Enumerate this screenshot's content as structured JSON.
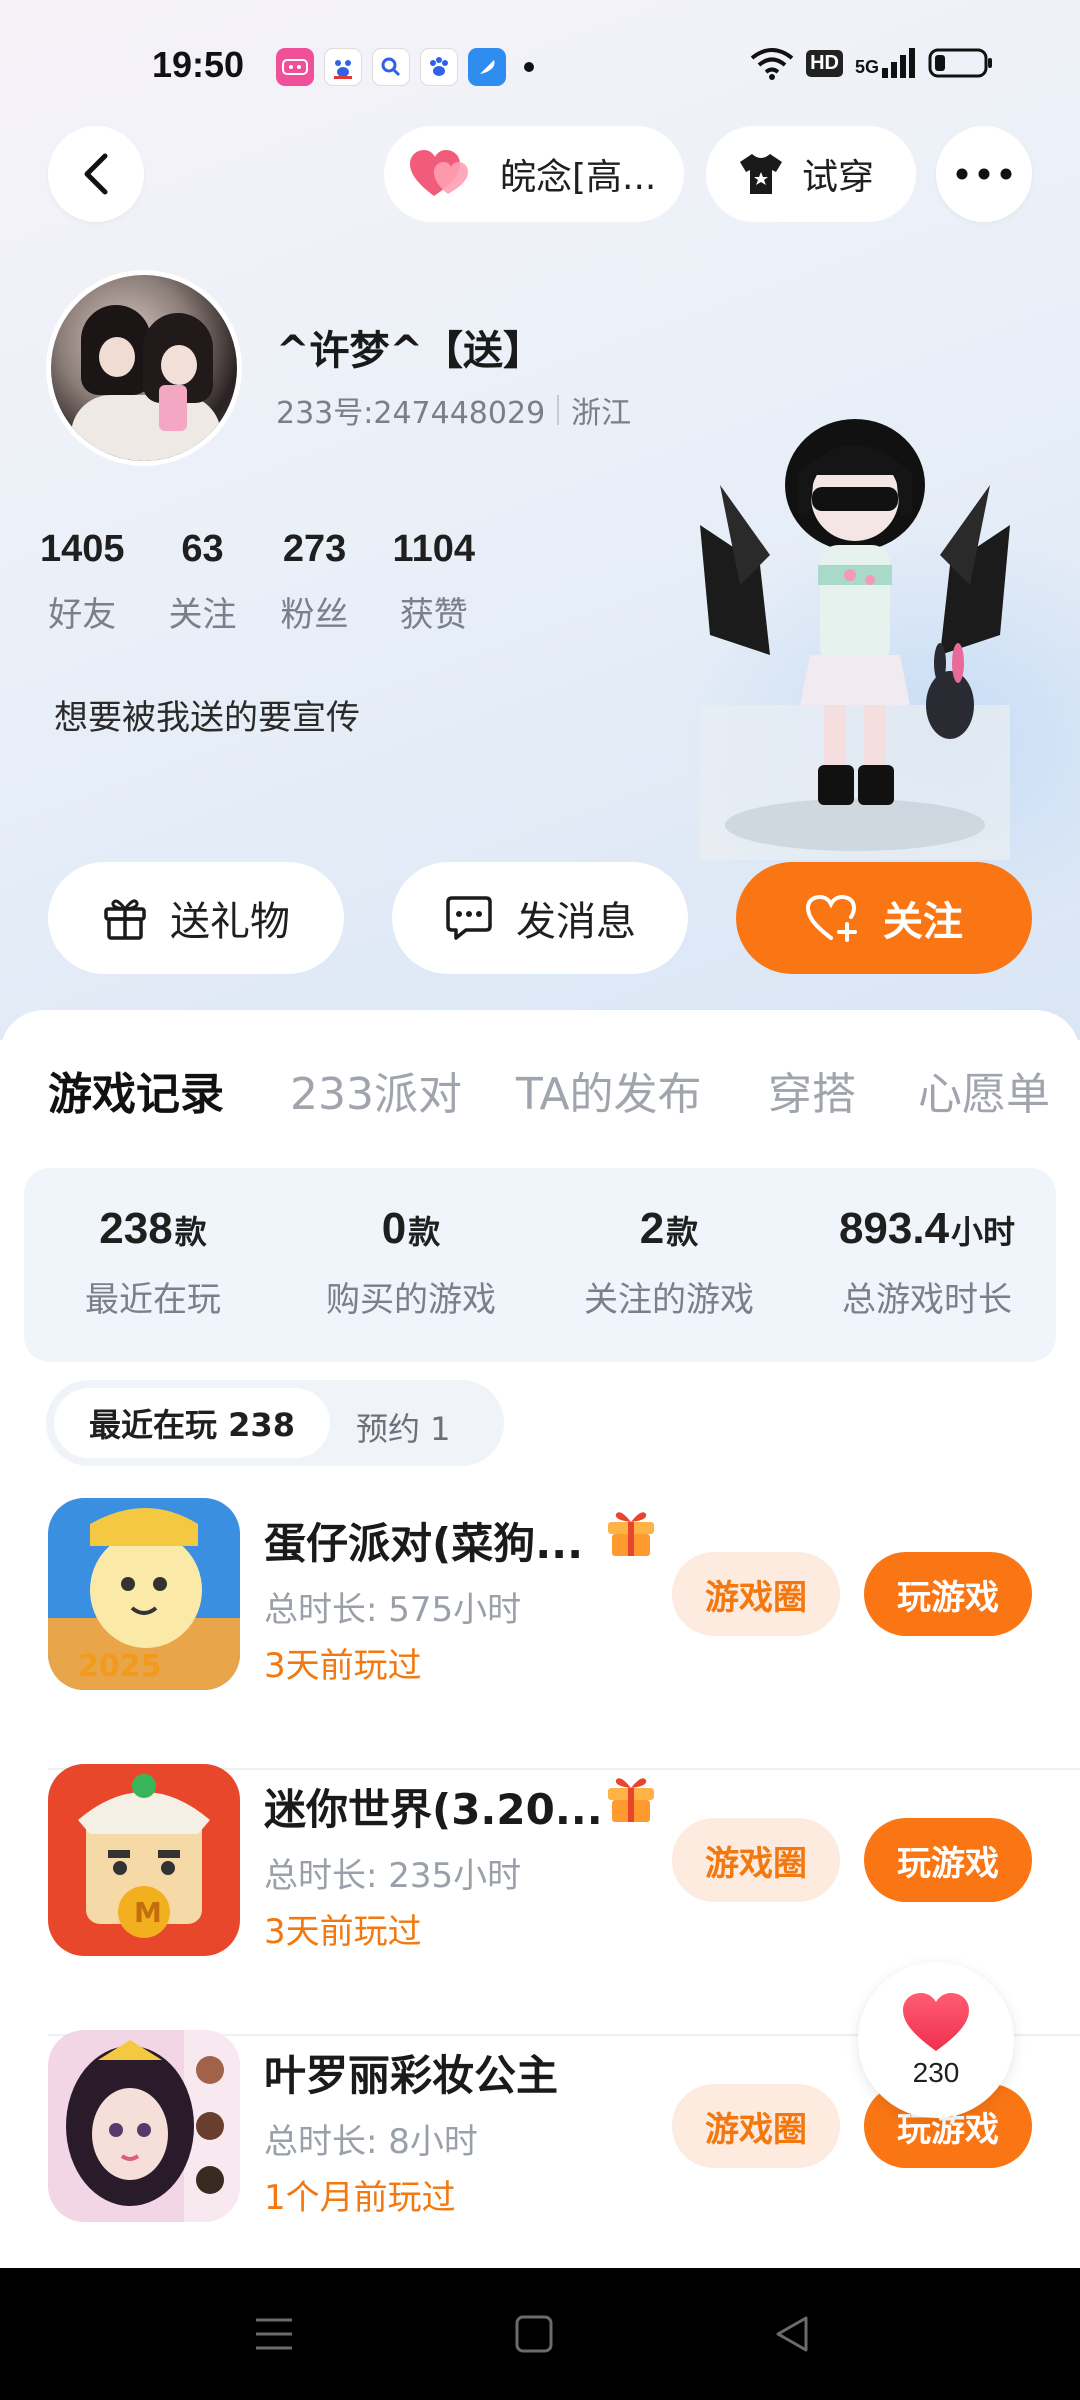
{
  "status_bar": {
    "time": "19:50",
    "network_label": "5G",
    "hd_label": "HD"
  },
  "header": {
    "friend_tag": "皖念[高...",
    "try_on_label": "试穿"
  },
  "profile": {
    "nickname": "^许梦^【送】",
    "uid": "233号:247448029",
    "region": "浙江",
    "bio": "想要被我送的要宣传",
    "stats": [
      {
        "value": "1405",
        "label": "好友"
      },
      {
        "value": "63",
        "label": "关注"
      },
      {
        "value": "273",
        "label": "粉丝"
      },
      {
        "value": "1104",
        "label": "获赞"
      }
    ]
  },
  "actions": {
    "gift": "送礼物",
    "message": "发消息",
    "follow": "关注"
  },
  "tabs": [
    {
      "label": "游戏记录",
      "active": true
    },
    {
      "label": "233派对",
      "active": false
    },
    {
      "label": "TA的发布",
      "active": false
    },
    {
      "label": "穿搭",
      "active": false
    },
    {
      "label": "心愿单",
      "active": false
    }
  ],
  "summary": [
    {
      "value": "238",
      "unit": "款",
      "label": "最近在玩"
    },
    {
      "value": "0",
      "unit": "款",
      "label": "购买的游戏"
    },
    {
      "value": "2",
      "unit": "款",
      "label": "关注的游戏"
    },
    {
      "value": "893.4",
      "unit": "小时",
      "label": "总游戏时长"
    }
  ],
  "subtabs": {
    "recent": "最近在玩 238",
    "reserve": "预约 1"
  },
  "games": [
    {
      "name": "蛋仔派对(菜狗...",
      "duration": "总时长:  575小时",
      "last_played": "3天前玩过",
      "has_gift": true,
      "circle_label": "游戏圈",
      "play_label": "玩游戏"
    },
    {
      "name": "迷你世界(3.20...",
      "duration": "总时长:  235小时",
      "last_played": "3天前玩过",
      "has_gift": true,
      "circle_label": "游戏圈",
      "play_label": "玩游戏"
    },
    {
      "name": "叶罗丽彩妆公主",
      "duration": "总时长:  8小时",
      "last_played": "1个月前玩过",
      "has_gift": false,
      "circle_label": "游戏圈",
      "play_label": "玩游戏"
    }
  ],
  "float_like": {
    "count": "230"
  },
  "colors": {
    "accent": "#fa7614",
    "accent_light": "#fdebe0",
    "heart": "#f24a63"
  }
}
